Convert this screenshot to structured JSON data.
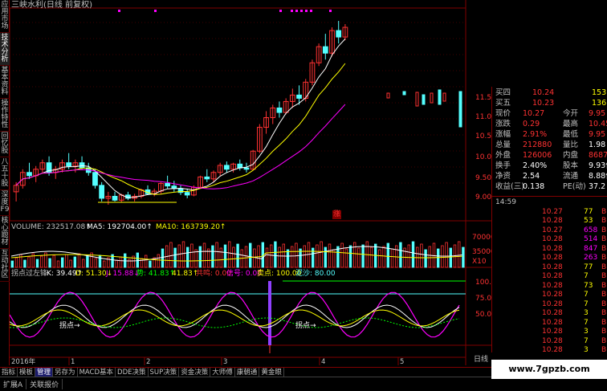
{
  "window": {
    "title": "三峡水利(日线 前复权)"
  },
  "left_tabs": [
    "应用市场",
    "技术分析",
    "基本资料",
    "操作特性",
    "回忆股",
    "八五十股",
    "深度F9",
    "核心题材",
    "互动社区"
  ],
  "bottom_tabs": [
    "指标",
    "模板",
    "管理",
    "另存为",
    "MACD基本",
    "DDE决策",
    "SUP决策",
    "资金决策",
    "大师傅",
    "康朝通",
    "黄金眼"
  ],
  "bottom_active": 2,
  "status_tabs": [
    "扩展A",
    "关联报价"
  ],
  "chart_header": {
    "volume": "VOLUME: 232517.08↑",
    "ma5": "MA5: 192704.00↑",
    "ma10": "MA10: 163739.20↑",
    "kdj_name": "拐点过左锋",
    "k": "K: 39.49↑",
    "d": "D: 51.30↓",
    "j": "J: 15.88↓",
    "shi": "势: 41.83↑",
    "val2": "41.83↑",
    "gongming": "共鸣: 0.00",
    "xinhao": "信号: 0.00",
    "maodian": "卖点: 100.00",
    "nisha": "泥沙: 80.00"
  },
  "price_axis": [
    "11.50",
    "11.00",
    "10.50",
    "10.00",
    "9.50",
    "9.00"
  ],
  "volume_axis": [
    "70000",
    "35000",
    "X10"
  ],
  "indicator_axis": [
    "100.00",
    "75.00",
    "50.00"
  ],
  "time_axis": [
    "2016年",
    "1",
    "2",
    "3",
    "4",
    "5"
  ],
  "annotations": {
    "zhang": "涨",
    "guaidian1": "拐点→",
    "guaidian2": "拐点→",
    "rixian": "日线"
  },
  "quote": {
    "rows": [
      {
        "label": "买四",
        "val": "10.24",
        "val2": "153"
      },
      {
        "label": "买五",
        "val": "10.23",
        "val2": "136"
      },
      {
        "label": "现价",
        "val": "10.27",
        "label2": "今开",
        "val3": "9.95"
      },
      {
        "label": "涨跌",
        "val": "0.29",
        "label2": "最高",
        "val3": "10.45"
      },
      {
        "label": "涨幅",
        "val": "2.91%",
        "label2": "最低",
        "val3": "9.95"
      },
      {
        "label": "总量",
        "val": "212880",
        "label2": "量比",
        "val3": "1.98"
      },
      {
        "label": "外盘",
        "val": "126006",
        "label2": "内盘",
        "val3": "86874"
      },
      {
        "label": "换手",
        "val": "2.40%",
        "label2": "股本",
        "val3": "9.93亿"
      },
      {
        "label": "净资",
        "val": "2.54",
        "label2": "流通",
        "val3": "8.88亿"
      },
      {
        "label": "收益(三)",
        "val": "0.138",
        "label2": "PE(动)",
        "val3": "37.2"
      }
    ]
  },
  "ticks": {
    "time": "14:59",
    "rows": [
      {
        "price": "10.27",
        "vol": "77",
        "bs": "B"
      },
      {
        "price": "10.28",
        "vol": "53",
        "bs": "B"
      },
      {
        "price": "10.27",
        "vol": "658",
        "bs": "B"
      },
      {
        "price": "10.28",
        "vol": "514",
        "bs": "B"
      },
      {
        "price": "10.28",
        "vol": "847",
        "bs": "B"
      },
      {
        "price": "10.28",
        "vol": "263",
        "bs": "B"
      },
      {
        "price": "10.28",
        "vol": "77",
        "bs": "B"
      },
      {
        "price": "10.28",
        "vol": "7",
        "bs": "B"
      },
      {
        "price": "10.28",
        "vol": "73",
        "bs": "B"
      },
      {
        "price": "10.28",
        "vol": "7",
        "bs": "B"
      },
      {
        "price": "10.28",
        "vol": "7",
        "bs": "B"
      },
      {
        "price": "10.28",
        "vol": "3",
        "bs": "B"
      },
      {
        "price": "10.28",
        "vol": "7",
        "bs": "B"
      },
      {
        "price": "10.28",
        "vol": "3",
        "bs": "B"
      },
      {
        "price": "10.28",
        "vol": "7",
        "bs": "B"
      },
      {
        "price": "10.28",
        "vol": "3",
        "bs": "B"
      }
    ]
  },
  "watermark": "www.7gpzb.com",
  "colors": {
    "up": "#ff3232",
    "down": "#54ffff",
    "grid": "#800000",
    "yellow": "#ffff00",
    "magenta": "#ff00ff",
    "green": "#00ff00"
  },
  "chart_data": {
    "type": "candlestick",
    "price_ylim": [
      8.9,
      11.95
    ],
    "candles": [
      [
        9.25,
        9.4,
        9.1,
        9.35
      ],
      [
        9.35,
        9.6,
        9.3,
        9.55
      ],
      [
        9.55,
        9.7,
        9.45,
        9.5
      ],
      [
        9.5,
        9.65,
        9.4,
        9.6
      ],
      [
        9.6,
        9.75,
        9.55,
        9.7
      ],
      [
        9.7,
        9.8,
        9.5,
        9.55
      ],
      [
        9.55,
        9.65,
        9.45,
        9.6
      ],
      [
        9.6,
        9.75,
        9.55,
        9.7
      ],
      [
        9.7,
        9.85,
        9.6,
        9.65
      ],
      [
        9.65,
        9.75,
        9.55,
        9.7
      ],
      [
        9.7,
        9.8,
        9.6,
        9.62
      ],
      [
        9.62,
        9.7,
        9.5,
        9.55
      ],
      [
        9.55,
        9.6,
        9.3,
        9.35
      ],
      [
        9.35,
        9.4,
        9.1,
        9.15
      ],
      [
        9.15,
        9.25,
        9.05,
        9.18
      ],
      [
        9.18,
        9.25,
        9.1,
        9.12
      ],
      [
        9.12,
        9.22,
        9.08,
        9.2
      ],
      [
        9.2,
        9.25,
        9.12,
        9.15
      ],
      [
        9.15,
        9.22,
        9.1,
        9.18
      ],
      [
        9.18,
        9.3,
        9.15,
        9.28
      ],
      [
        9.28,
        9.35,
        9.2,
        9.22
      ],
      [
        9.22,
        9.3,
        9.18,
        9.26
      ],
      [
        9.26,
        9.4,
        9.22,
        9.38
      ],
      [
        9.38,
        9.5,
        9.3,
        9.34
      ],
      [
        9.34,
        9.42,
        9.25,
        9.3
      ],
      [
        9.3,
        9.35,
        9.2,
        9.24
      ],
      [
        9.24,
        9.3,
        9.15,
        9.2
      ],
      [
        9.2,
        9.35,
        9.18,
        9.32
      ],
      [
        9.32,
        9.5,
        9.3,
        9.48
      ],
      [
        9.48,
        9.6,
        9.4,
        9.45
      ],
      [
        9.45,
        9.58,
        9.4,
        9.55
      ],
      [
        9.55,
        9.7,
        9.5,
        9.66
      ],
      [
        9.66,
        9.72,
        9.55,
        9.6
      ],
      [
        9.6,
        9.7,
        9.55,
        9.68
      ],
      [
        9.68,
        9.75,
        9.58,
        9.62
      ],
      [
        9.62,
        9.7,
        9.55,
        9.6
      ],
      [
        9.6,
        9.9,
        9.58,
        9.88
      ],
      [
        9.88,
        10.3,
        9.85,
        10.25
      ],
      [
        10.25,
        10.5,
        10.15,
        10.4
      ],
      [
        10.4,
        10.6,
        10.3,
        10.55
      ],
      [
        10.55,
        10.65,
        10.4,
        10.48
      ],
      [
        10.48,
        10.7,
        10.45,
        10.65
      ],
      [
        10.65,
        10.85,
        10.55,
        10.75
      ],
      [
        10.75,
        10.9,
        10.6,
        10.7
      ],
      [
        10.7,
        11.0,
        10.65,
        10.95
      ],
      [
        10.95,
        11.3,
        10.9,
        11.25
      ],
      [
        11.25,
        11.55,
        11.2,
        11.5
      ],
      [
        11.5,
        11.7,
        11.3,
        11.4
      ],
      [
        11.4,
        11.8,
        11.35,
        11.75
      ],
      [
        11.75,
        11.9,
        11.55,
        11.65
      ],
      [
        11.65,
        11.85,
        11.6,
        11.8
      ]
    ]
  }
}
